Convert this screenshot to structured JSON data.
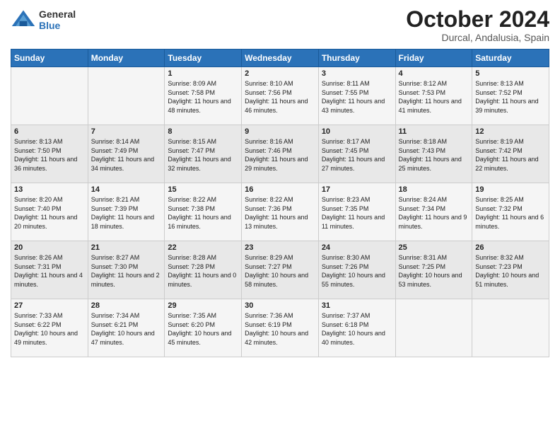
{
  "header": {
    "logo": {
      "general": "General",
      "blue": "Blue"
    },
    "title": "October 2024",
    "location": "Durcal, Andalusia, Spain"
  },
  "weekdays": [
    "Sunday",
    "Monday",
    "Tuesday",
    "Wednesday",
    "Thursday",
    "Friday",
    "Saturday"
  ],
  "weeks": [
    [
      {
        "day": "",
        "info": ""
      },
      {
        "day": "",
        "info": ""
      },
      {
        "day": "1",
        "info": "Sunrise: 8:09 AM\nSunset: 7:58 PM\nDaylight: 11 hours and 48 minutes."
      },
      {
        "day": "2",
        "info": "Sunrise: 8:10 AM\nSunset: 7:56 PM\nDaylight: 11 hours and 46 minutes."
      },
      {
        "day": "3",
        "info": "Sunrise: 8:11 AM\nSunset: 7:55 PM\nDaylight: 11 hours and 43 minutes."
      },
      {
        "day": "4",
        "info": "Sunrise: 8:12 AM\nSunset: 7:53 PM\nDaylight: 11 hours and 41 minutes."
      },
      {
        "day": "5",
        "info": "Sunrise: 8:13 AM\nSunset: 7:52 PM\nDaylight: 11 hours and 39 minutes."
      }
    ],
    [
      {
        "day": "6",
        "info": "Sunrise: 8:13 AM\nSunset: 7:50 PM\nDaylight: 11 hours and 36 minutes."
      },
      {
        "day": "7",
        "info": "Sunrise: 8:14 AM\nSunset: 7:49 PM\nDaylight: 11 hours and 34 minutes."
      },
      {
        "day": "8",
        "info": "Sunrise: 8:15 AM\nSunset: 7:47 PM\nDaylight: 11 hours and 32 minutes."
      },
      {
        "day": "9",
        "info": "Sunrise: 8:16 AM\nSunset: 7:46 PM\nDaylight: 11 hours and 29 minutes."
      },
      {
        "day": "10",
        "info": "Sunrise: 8:17 AM\nSunset: 7:45 PM\nDaylight: 11 hours and 27 minutes."
      },
      {
        "day": "11",
        "info": "Sunrise: 8:18 AM\nSunset: 7:43 PM\nDaylight: 11 hours and 25 minutes."
      },
      {
        "day": "12",
        "info": "Sunrise: 8:19 AM\nSunset: 7:42 PM\nDaylight: 11 hours and 22 minutes."
      }
    ],
    [
      {
        "day": "13",
        "info": "Sunrise: 8:20 AM\nSunset: 7:40 PM\nDaylight: 11 hours and 20 minutes."
      },
      {
        "day": "14",
        "info": "Sunrise: 8:21 AM\nSunset: 7:39 PM\nDaylight: 11 hours and 18 minutes."
      },
      {
        "day": "15",
        "info": "Sunrise: 8:22 AM\nSunset: 7:38 PM\nDaylight: 11 hours and 16 minutes."
      },
      {
        "day": "16",
        "info": "Sunrise: 8:22 AM\nSunset: 7:36 PM\nDaylight: 11 hours and 13 minutes."
      },
      {
        "day": "17",
        "info": "Sunrise: 8:23 AM\nSunset: 7:35 PM\nDaylight: 11 hours and 11 minutes."
      },
      {
        "day": "18",
        "info": "Sunrise: 8:24 AM\nSunset: 7:34 PM\nDaylight: 11 hours and 9 minutes."
      },
      {
        "day": "19",
        "info": "Sunrise: 8:25 AM\nSunset: 7:32 PM\nDaylight: 11 hours and 6 minutes."
      }
    ],
    [
      {
        "day": "20",
        "info": "Sunrise: 8:26 AM\nSunset: 7:31 PM\nDaylight: 11 hours and 4 minutes."
      },
      {
        "day": "21",
        "info": "Sunrise: 8:27 AM\nSunset: 7:30 PM\nDaylight: 11 hours and 2 minutes."
      },
      {
        "day": "22",
        "info": "Sunrise: 8:28 AM\nSunset: 7:28 PM\nDaylight: 11 hours and 0 minutes."
      },
      {
        "day": "23",
        "info": "Sunrise: 8:29 AM\nSunset: 7:27 PM\nDaylight: 10 hours and 58 minutes."
      },
      {
        "day": "24",
        "info": "Sunrise: 8:30 AM\nSunset: 7:26 PM\nDaylight: 10 hours and 55 minutes."
      },
      {
        "day": "25",
        "info": "Sunrise: 8:31 AM\nSunset: 7:25 PM\nDaylight: 10 hours and 53 minutes."
      },
      {
        "day": "26",
        "info": "Sunrise: 8:32 AM\nSunset: 7:23 PM\nDaylight: 10 hours and 51 minutes."
      }
    ],
    [
      {
        "day": "27",
        "info": "Sunrise: 7:33 AM\nSunset: 6:22 PM\nDaylight: 10 hours and 49 minutes."
      },
      {
        "day": "28",
        "info": "Sunrise: 7:34 AM\nSunset: 6:21 PM\nDaylight: 10 hours and 47 minutes."
      },
      {
        "day": "29",
        "info": "Sunrise: 7:35 AM\nSunset: 6:20 PM\nDaylight: 10 hours and 45 minutes."
      },
      {
        "day": "30",
        "info": "Sunrise: 7:36 AM\nSunset: 6:19 PM\nDaylight: 10 hours and 42 minutes."
      },
      {
        "day": "31",
        "info": "Sunrise: 7:37 AM\nSunset: 6:18 PM\nDaylight: 10 hours and 40 minutes."
      },
      {
        "day": "",
        "info": ""
      },
      {
        "day": "",
        "info": ""
      }
    ]
  ]
}
